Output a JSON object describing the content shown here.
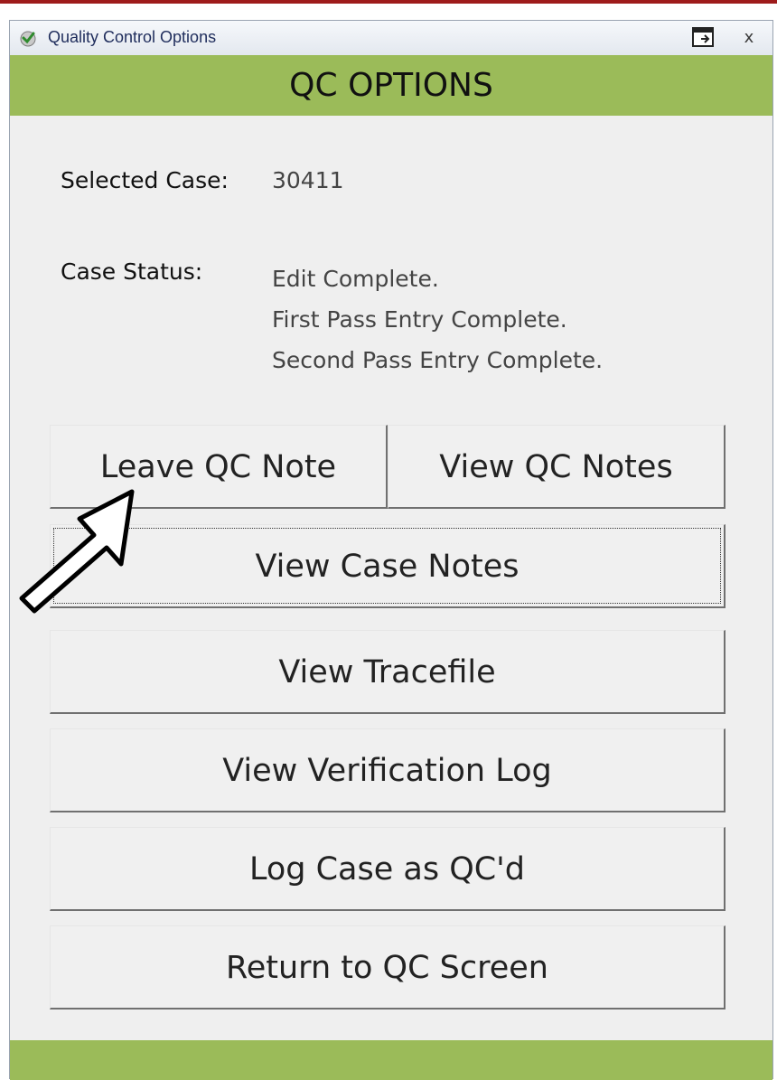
{
  "window": {
    "title": "Quality Control Options",
    "close_glyph": "x",
    "icons": {
      "app": "checkmark-app-icon",
      "restore": "restore-window-icon",
      "close": "close-icon"
    }
  },
  "header": {
    "title": "QC OPTIONS"
  },
  "case": {
    "selected_label": "Selected Case:",
    "selected_value": "30411",
    "status_label": "Case Status:",
    "status_lines": [
      "Edit Complete.",
      "First Pass Entry Complete.",
      "Second Pass Entry Complete."
    ]
  },
  "buttons": {
    "leave_qc_note": "Leave QC Note",
    "view_qc_notes": "View QC Notes",
    "view_case_notes": "View Case Notes",
    "view_tracefile": "View Tracefile",
    "view_verification_log": "View Verification Log",
    "log_case_qcd": "Log Case as QC'd",
    "return_to_qc_screen": "Return to QC Screen"
  },
  "colors": {
    "accent_green": "#9bbb59",
    "top_border_red": "#9e1b1b",
    "window_bg": "#efefef"
  }
}
